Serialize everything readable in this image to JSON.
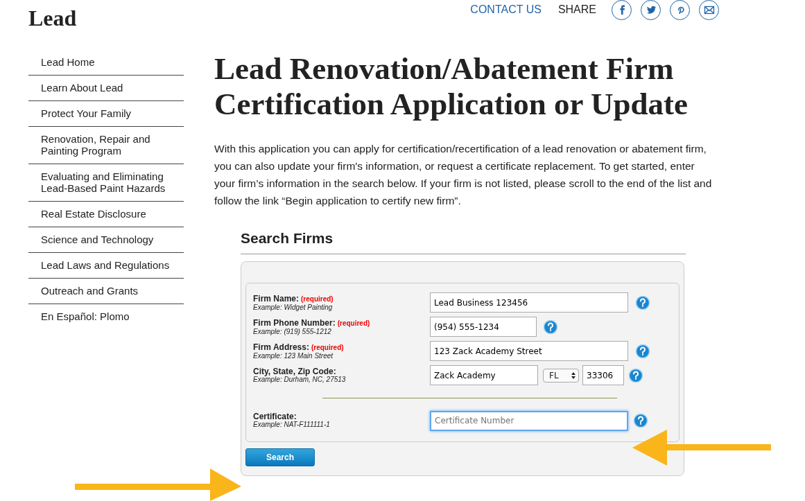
{
  "site_title": "Lead",
  "top_links": {
    "contact": "CONTACT US",
    "share": "SHARE",
    "share_icons": [
      {
        "kind": "facebook"
      },
      {
        "kind": "twitter"
      },
      {
        "kind": "pinterest"
      },
      {
        "kind": "email"
      }
    ]
  },
  "sidebar": {
    "items": [
      {
        "label": "Lead Home"
      },
      {
        "label": "Learn About Lead"
      },
      {
        "label": "Protect Your Family"
      },
      {
        "label": "Renovation, Repair and Painting Program"
      },
      {
        "label": "Evaluating and Eliminating Lead-Based Paint Hazards"
      },
      {
        "label": "Real Estate Disclosure"
      },
      {
        "label": "Science and Technology"
      },
      {
        "label": "Lead Laws and Regulations"
      },
      {
        "label": "Outreach and Grants"
      },
      {
        "label": "En Español: Plomo"
      }
    ]
  },
  "page_title": "Lead Renovation/Abatement Firm Certification Application or Update",
  "intro": "With this application you can apply for certification/recertification of a lead renovation or abatement firm, you can also update your firm's information, or request a certificate replacement.  To get started, enter your firm’s information in the search below.  If your firm is not listed, please scroll to the end of the list and follow the link “Begin application to certify new firm”.",
  "search_heading": "Search Firms",
  "fields": [
    {
      "kind": "wide",
      "label": "Firm Name:",
      "required": "(required)",
      "example": "Example: Widget Painting",
      "value": "Lead Business 123456"
    },
    {
      "kind": "short",
      "label": "Firm Phone Number:",
      "required": "(required)",
      "example": "Example: (919) 555-1212",
      "value": "(954) 555-1234"
    },
    {
      "kind": "wide",
      "label": "Firm Address:",
      "required": "(required)",
      "example": "Example: 123 Main Street",
      "value": "123 Zack Academy Street"
    },
    {
      "kind": "city",
      "label": "City, State, Zip Code:",
      "example": "Example: Durham, NC, 27513",
      "value": "Zack Academy",
      "state": "FL",
      "zip": "33306"
    }
  ],
  "certificate": {
    "label": "Certificate:",
    "example": "Example: NAT-F111111-1",
    "placeholder": "Certificate Number",
    "focused": true
  },
  "search_button": "Search"
}
